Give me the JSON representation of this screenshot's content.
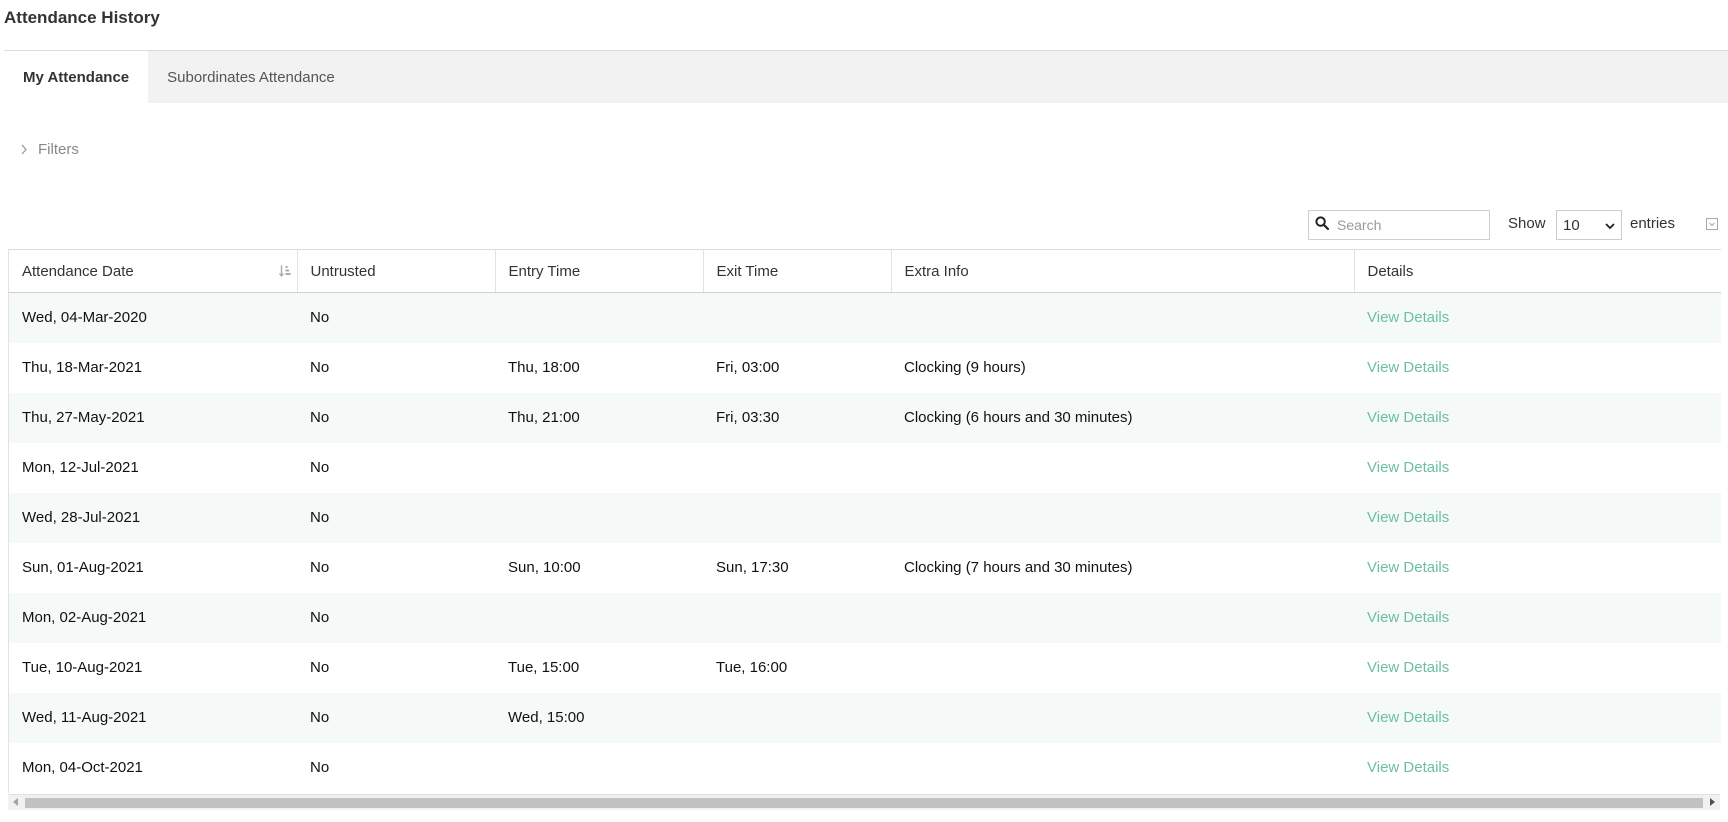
{
  "page": {
    "title": "Attendance History"
  },
  "tabs": [
    {
      "label": "My Attendance",
      "active": true
    },
    {
      "label": "Subordinates Attendance",
      "active": false
    }
  ],
  "filters": {
    "label": "Filters",
    "icon": "chevron-right-icon"
  },
  "toolbar": {
    "search_placeholder": "Search",
    "search_icon": "search-icon",
    "show_label": "Show",
    "entries_value": "10",
    "entries_label": "entries",
    "export_icon": "export-icon"
  },
  "table": {
    "columns": [
      "Attendance Date",
      "Untrusted",
      "Entry Time",
      "Exit Time",
      "Extra Info",
      "Details"
    ],
    "sort_icon": "sort-descending-icon",
    "rows": [
      {
        "date": "Wed, 04-Mar-2020",
        "untrusted": "No",
        "entry": "",
        "exit": "",
        "extra": "",
        "details": "View Details"
      },
      {
        "date": "Thu, 18-Mar-2021",
        "untrusted": "No",
        "entry": "Thu, 18:00",
        "exit": "Fri, 03:00",
        "extra": "Clocking (9 hours)",
        "details": "View Details"
      },
      {
        "date": "Thu, 27-May-2021",
        "untrusted": "No",
        "entry": "Thu, 21:00",
        "exit": "Fri, 03:30",
        "extra": "Clocking (6 hours and 30 minutes)",
        "details": "View Details"
      },
      {
        "date": "Mon, 12-Jul-2021",
        "untrusted": "No",
        "entry": "",
        "exit": "",
        "extra": "",
        "details": "View Details"
      },
      {
        "date": "Wed, 28-Jul-2021",
        "untrusted": "No",
        "entry": "",
        "exit": "",
        "extra": "",
        "details": "View Details"
      },
      {
        "date": "Sun, 01-Aug-2021",
        "untrusted": "No",
        "entry": "Sun, 10:00",
        "exit": "Sun, 17:30",
        "extra": "Clocking (7 hours and 30 minutes)",
        "details": "View Details"
      },
      {
        "date": "Mon, 02-Aug-2021",
        "untrusted": "No",
        "entry": "",
        "exit": "",
        "extra": "",
        "details": "View Details"
      },
      {
        "date": "Tue, 10-Aug-2021",
        "untrusted": "No",
        "entry": "Tue, 15:00",
        "exit": "Tue, 16:00",
        "extra": "",
        "details": "View Details"
      },
      {
        "date": "Wed, 11-Aug-2021",
        "untrusted": "No",
        "entry": "Wed, 15:00",
        "exit": "",
        "extra": "",
        "details": "View Details"
      },
      {
        "date": "Mon, 04-Oct-2021",
        "untrusted": "No",
        "entry": "",
        "exit": "",
        "extra": "",
        "details": "View Details"
      }
    ]
  },
  "colors": {
    "link": "#6cbfa0",
    "row_alt": "#f5faf8",
    "tab_bar": "#f2f2f2"
  }
}
